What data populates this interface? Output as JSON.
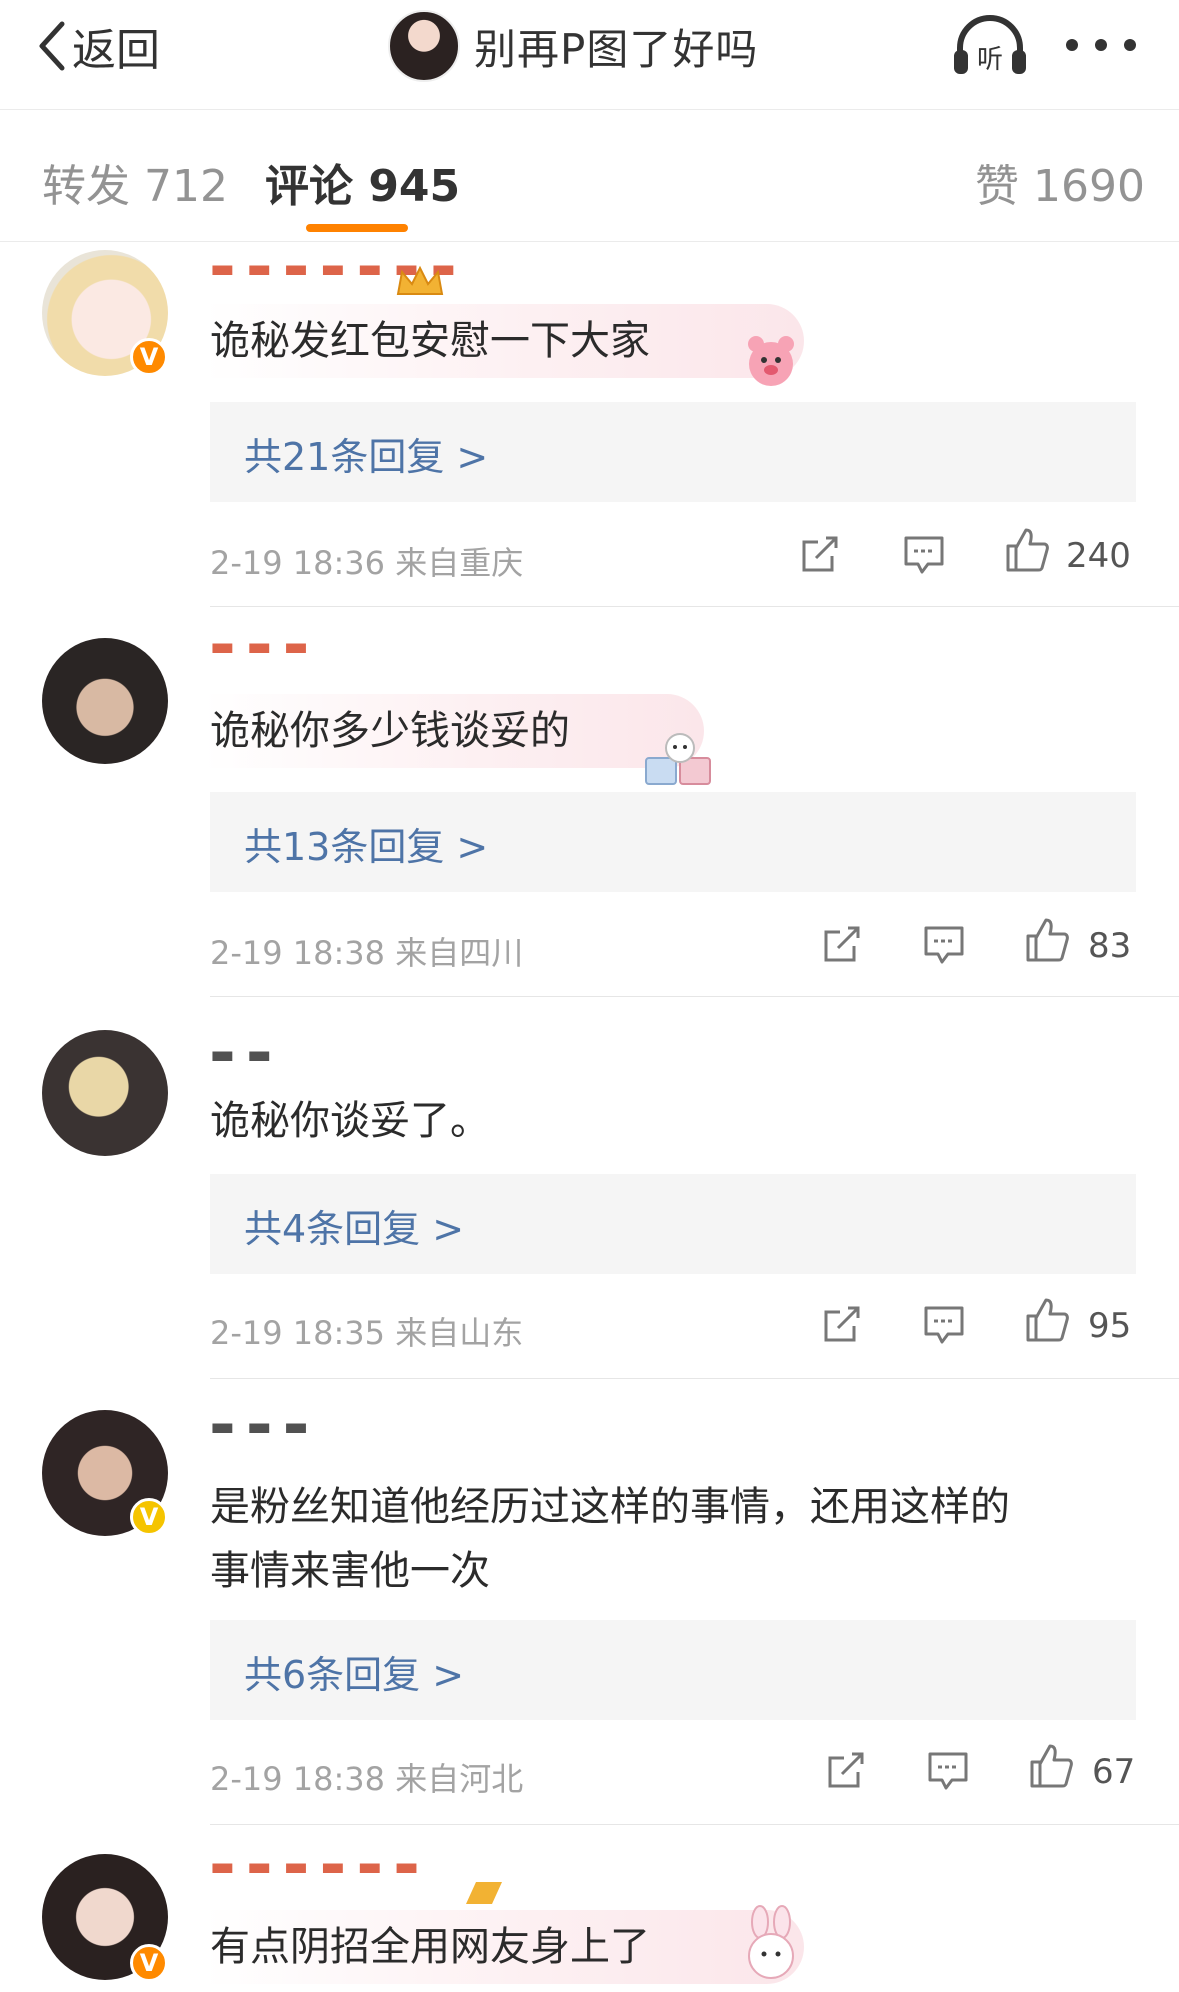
{
  "header": {
    "back_label": "返回",
    "title": "别再P图了好吗",
    "listen_label": "听"
  },
  "tabs": {
    "repost": "转发 712",
    "comments": "评论 945",
    "likes": "赞 1690"
  },
  "colors": {
    "accent": "#ff8200",
    "reply_link": "#4e74a7",
    "badge": "#ff8a00"
  },
  "comments": [
    {
      "text": "诡秘发红包安慰一下大家",
      "replies": "共21条回复 >",
      "meta": "2-19 18:36  来自重庆",
      "likes": "240",
      "verified": true
    },
    {
      "text": "诡秘你多少钱谈妥的",
      "replies": "共13条回复 >",
      "meta": "2-19 18:38  来自四川",
      "likes": "83",
      "verified": false
    },
    {
      "text": "诡秘你谈妥了。",
      "replies": "共4条回复 >",
      "meta": "2-19 18:35  来自山东",
      "likes": "95",
      "verified": false
    },
    {
      "text_line1": "是粉丝知道他经历过这样的事情，还用这样的",
      "text_line2": "事情来害他一次",
      "replies": "共6条回复 >",
      "meta": "2-19 18:38  来自河北",
      "likes": "67",
      "verified": true
    },
    {
      "text": "有点阴招全用网友身上了",
      "verified": true
    }
  ]
}
